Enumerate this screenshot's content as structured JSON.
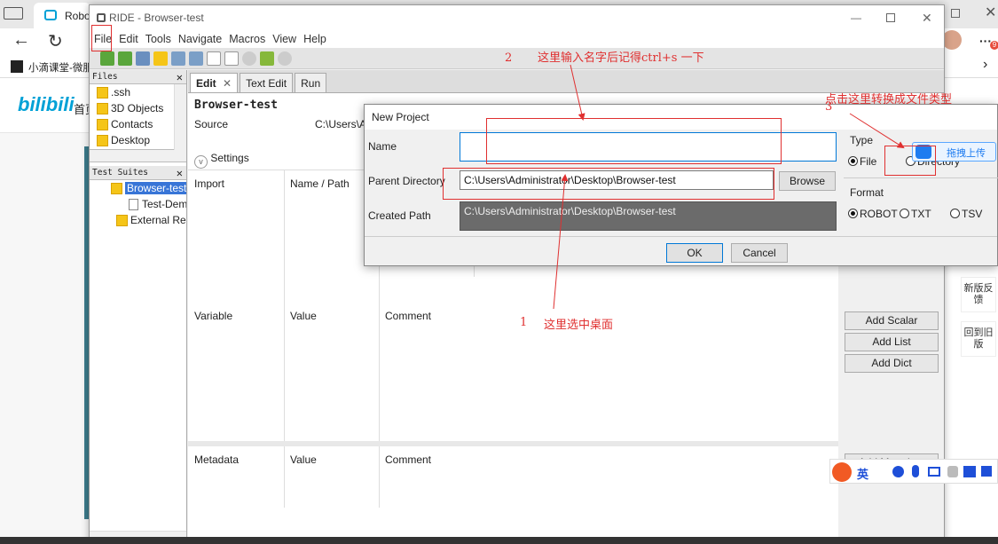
{
  "browser": {
    "tab1_label": "Robo",
    "bookmark1": "小滴课堂-微服",
    "more_dots": "···"
  },
  "bilibili": {
    "logo": "bilibili",
    "nav_first": "首页",
    "side_btn1": "新版反馈",
    "side_btn2": "回到旧版",
    "badge": "9"
  },
  "ride": {
    "title": "RIDE - Browser-test",
    "menu": [
      "File",
      "Edit",
      "Tools",
      "Navigate",
      "Macros",
      "View",
      "Help"
    ],
    "files_header": "Files",
    "files": [
      ".ssh",
      "3D Objects",
      "Contacts",
      "Desktop"
    ],
    "suites_header": "Test Suites",
    "suites": [
      "Browser-test",
      "Test-Dem",
      "External Re"
    ],
    "tabs": [
      "Edit",
      "Text Edit",
      "Run"
    ],
    "suite_name": "Browser-test",
    "source_label": "Source",
    "source_value": "C:\\Users\\A",
    "settings_label": "Settings",
    "import_headers": [
      "Import",
      "Name / Path"
    ],
    "variable_headers": [
      "Variable",
      "Value",
      "Comment"
    ],
    "metadata_headers": [
      "Metadata",
      "Value",
      "Comment"
    ],
    "buttons": {
      "add_scalar": "Add Scalar",
      "add_list": "Add List",
      "add_dict": "Add Dict",
      "add_metadata": "Add Metadata"
    }
  },
  "dialog": {
    "title": "New Project",
    "name_label": "Name",
    "name_value": "",
    "parent_label": "Parent Directory",
    "parent_value": "C:\\Users\\Administrator\\Desktop\\Browser-test",
    "browse": "Browse",
    "created_label": "Created Path",
    "created_value": "C:\\Users\\Administrator\\Desktop\\Browser-test",
    "type_label": "Type",
    "type_file": "File",
    "type_dir": "Directory",
    "format_label": "Format",
    "format_robot": "ROBOT",
    "format_txt": "TXT",
    "format_tsv": "TSV",
    "ok": "OK",
    "cancel": "Cancel"
  },
  "upload_widget": "拖拽上传",
  "annotations": {
    "a1_num": "1",
    "a1_text": "这里选中桌面",
    "a2_num": "2",
    "a2_text": "这里输入名字后记得ctrl+s 一下",
    "a3_num": "3",
    "a3_text": "点击这里转换成文件类型"
  },
  "ime": {
    "lang": "英"
  },
  "colors": {
    "annotation": "#e03030",
    "bili_blue": "#00a1d6",
    "bili_pink": "#fb7299"
  }
}
